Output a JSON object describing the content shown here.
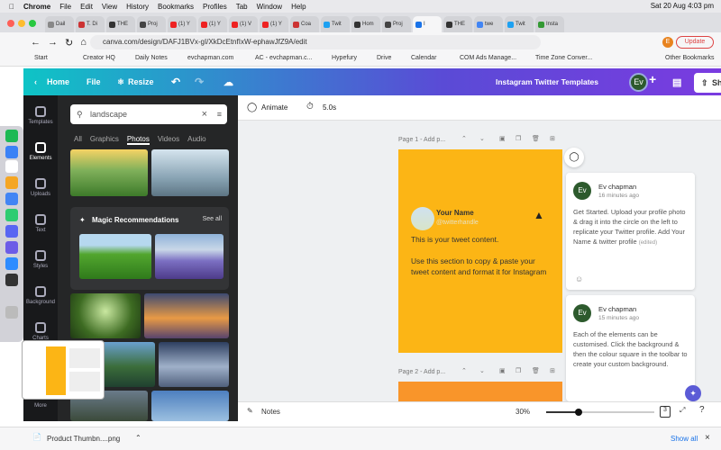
{
  "mac": {
    "menus": [
      "Chrome",
      "File",
      "Edit",
      "View",
      "History",
      "Bookmarks",
      "Profiles",
      "Tab",
      "Window",
      "Help"
    ],
    "datetime": "Sat 20 Aug  4:03 pm"
  },
  "tabs": [
    "Dail",
    "T. Di",
    "THE",
    "Proj",
    "(1) Y",
    "(1) Y",
    "(1) V",
    "(1) Y",
    "Coa",
    "Twit",
    "Hom",
    "Proj",
    "I",
    "THE",
    "twe",
    "Twit",
    "Insta"
  ],
  "address": {
    "url": "canva.com/design/DAFJ1BVx-gI/XkDcEtnfIxW-ephawJfZ9A/edit",
    "update_label": "Update",
    "profile_initial": "E"
  },
  "bookmarks": [
    "Start",
    "Creator HQ",
    "Daily Notes",
    "evchapman.com",
    "AC - evchapman.c...",
    "Hypefury",
    "Drive",
    "Calendar",
    "COM Ads Manage...",
    "Time Zone Conver...",
    "Other Bookmarks"
  ],
  "header": {
    "home": "Home",
    "file": "File",
    "resize": "Resize",
    "title": "Instagram Twitter Templates",
    "avatar": "Ev",
    "share": "Share"
  },
  "rail": [
    "Templates",
    "Elements",
    "Uploads",
    "Text",
    "Styles",
    "Background",
    "Charts",
    "More"
  ],
  "panel": {
    "search_value": "landscape",
    "categories": [
      "All",
      "Graphics",
      "Photos",
      "Videos",
      "Audio"
    ],
    "active_category": "Photos",
    "magic_title": "Magic Recommendations",
    "see_all": "See all"
  },
  "toolbar": {
    "animate": "Animate",
    "duration": "5.0s"
  },
  "pages": {
    "page1_label": "Page 1 - Add p...",
    "page2_label": "Page 2 - Add p..."
  },
  "tweet": {
    "name": "Your Name",
    "handle": "@twitterhandle",
    "line1": "This is your tweet content.",
    "line2": "Use this section to copy & paste your tweet content and format it for Instagram"
  },
  "comments": [
    {
      "author": "Ev chapman",
      "time": "16 minutes ago",
      "text": "Get Started. Upload your profile photo & drag it into the circle on the left to replicate your Twitter profile. Add Your Name & twitter profile",
      "edited": "(edited)"
    },
    {
      "author": "Ev chapman",
      "time": "15 minutes ago",
      "text": "Each of the elements can be customised. Click the background & then the colour square in the toolbar to create your custom background."
    }
  ],
  "bottom": {
    "notes": "Notes",
    "zoom": "30%",
    "zoom_fraction": 0.3,
    "page_count": "3"
  },
  "download": {
    "file": "Product Thumbn....png",
    "show_all": "Show all"
  }
}
